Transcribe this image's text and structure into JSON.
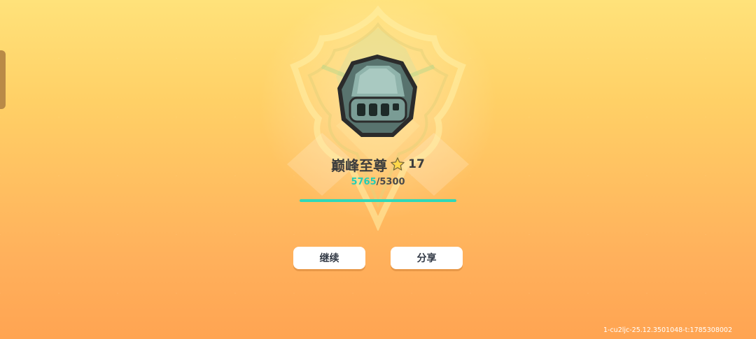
{
  "rank": {
    "name": "巅峰至尊",
    "level": "17",
    "icon": "helmet-icon"
  },
  "score": {
    "current": "5765",
    "separator": "/",
    "total": "5300",
    "progress_fraction": 1.0
  },
  "buttons": {
    "continue_label": "继续",
    "share_label": "分享"
  },
  "footer": {
    "version_text": "1-cu2ljc-25.12.3501048-t:1785308002"
  },
  "colors": {
    "accent": "#2fd8b8",
    "background_top": "#ffe27a",
    "background_bottom": "#ffa452"
  }
}
